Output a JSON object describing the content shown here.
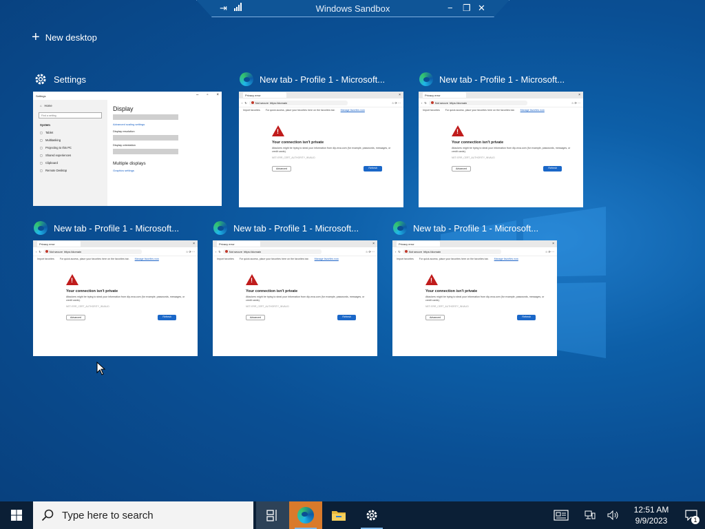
{
  "sandbox_bar": {
    "title": "Windows Sandbox",
    "pin_icon": "pin-icon",
    "signal_icon": "signal-icon",
    "minimize_icon": "minimize-icon",
    "restore_icon": "restore-icon",
    "close_icon": "close-icon"
  },
  "task_view": {
    "new_desktop_label": "New desktop",
    "windows": [
      {
        "title": "Settings",
        "app": "settings"
      },
      {
        "title": "New tab - Profile 1 - Microsoft...",
        "app": "edge"
      },
      {
        "title": "New tab - Profile 1 - Microsoft...",
        "app": "edge"
      },
      {
        "title": "New tab - Profile 1 - Microsoft...",
        "app": "edge"
      },
      {
        "title": "New tab - Profile 1 - Microsoft...",
        "app": "edge"
      },
      {
        "title": "New tab - Profile 1 - Microsoft...",
        "app": "edge"
      }
    ]
  },
  "settings_thumb": {
    "window_title": "Settings",
    "home": "Home",
    "search_placeholder": "Find a setting",
    "section": "System",
    "nav": [
      "Tablet",
      "Multitasking",
      "Projecting to this PC",
      "Shared experiences",
      "Clipboard",
      "Remote Desktop"
    ],
    "heading": "Display",
    "advanced_link": "Advanced scaling settings",
    "resolution_label": "Display resolution",
    "orientation_label": "Display orientation",
    "multiple_displays": "Multiple displays",
    "graphics_link": "Graphics settings"
  },
  "browser_thumb": {
    "tab_label": "Privacy error",
    "url_state": "Not secure",
    "url_text": "https://domain",
    "favbar_text": "For quick access, place your favorites here on the favorites bar.",
    "favbar_link": "Manage favorites now",
    "import_label": "Import favorites",
    "heading": "Your connection isn't private",
    "body": "Attackers might be trying to steal your information from dlp-mxa.com (for example, passwords, messages, or credit cards).",
    "code": "NET::ERR_CERT_AUTHORITY_INVALID",
    "advanced": "Advanced",
    "refresh": "Refresh"
  },
  "taskbar": {
    "search_placeholder": "Type here to search",
    "time": "12:51 AM",
    "date": "9/9/2023",
    "notification_count": "1"
  },
  "colors": {
    "desktop": "#0a4f94",
    "taskbar": "#0b1f36",
    "edge_active": "#d97a2b"
  }
}
